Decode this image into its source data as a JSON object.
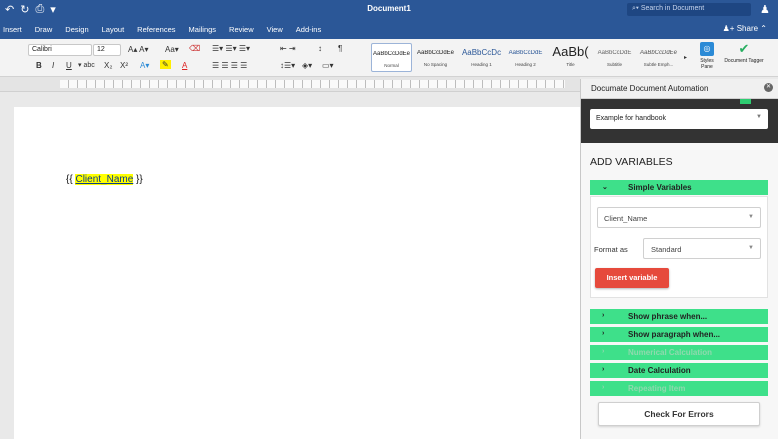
{
  "titlebar": {
    "title": "Document1",
    "search_placeholder": "Search in Document",
    "quick_access": [
      "↶",
      "↻",
      "⎙",
      "▾"
    ]
  },
  "menubar": {
    "items": [
      "Insert",
      "Draw",
      "Design",
      "Layout",
      "References",
      "Mailings",
      "Review",
      "View",
      "Add-ins"
    ],
    "share_label": "Share"
  },
  "ribbon": {
    "font_name": "Calibri",
    "font_size": "12",
    "styles": [
      {
        "sample": "AaBbCcDdEe",
        "label": "Normal"
      },
      {
        "sample": "AaBbCcDdEe",
        "label": "No Spacing"
      },
      {
        "sample": "AaBbCcDc",
        "label": "Heading 1"
      },
      {
        "sample": "AaBbCcDdE",
        "label": "Heading 2"
      },
      {
        "sample": "AaBb(",
        "label": "Title"
      },
      {
        "sample": "AaBbCcDdE",
        "label": "Subtitle"
      },
      {
        "sample": "AaBbCcDdEe",
        "label": "Subtle Emph..."
      }
    ],
    "styles_pane_label": "Styles Pane",
    "document_tagger_label": "Document Tagger"
  },
  "document": {
    "open_braces": "{{ ",
    "variable": "Client_Name",
    "close_braces": " }}"
  },
  "taskpane": {
    "title": "Documate Document Automation",
    "interview_select": "Example for handbook",
    "section_title": "ADD VARIABLES",
    "simple_variables": "Simple Variables",
    "variable_select": "Client_Name",
    "format_label": "Format as",
    "format_value": "Standard",
    "insert_button": "Insert variable",
    "sections": [
      {
        "label": "Show phrase when...",
        "disabled": false
      },
      {
        "label": "Show paragraph when...",
        "disabled": false
      },
      {
        "label": "Numerical Calculation",
        "disabled": true
      },
      {
        "label": "Date Calculation",
        "disabled": false
      },
      {
        "label": "Repeating Item",
        "disabled": true
      }
    ],
    "check_button": "Check For Errors"
  },
  "colors": {
    "accent_blue": "#2b5797",
    "green_bar": "#3ee08a",
    "insert_red": "#e64a3c",
    "highlight": "#ffff00"
  }
}
